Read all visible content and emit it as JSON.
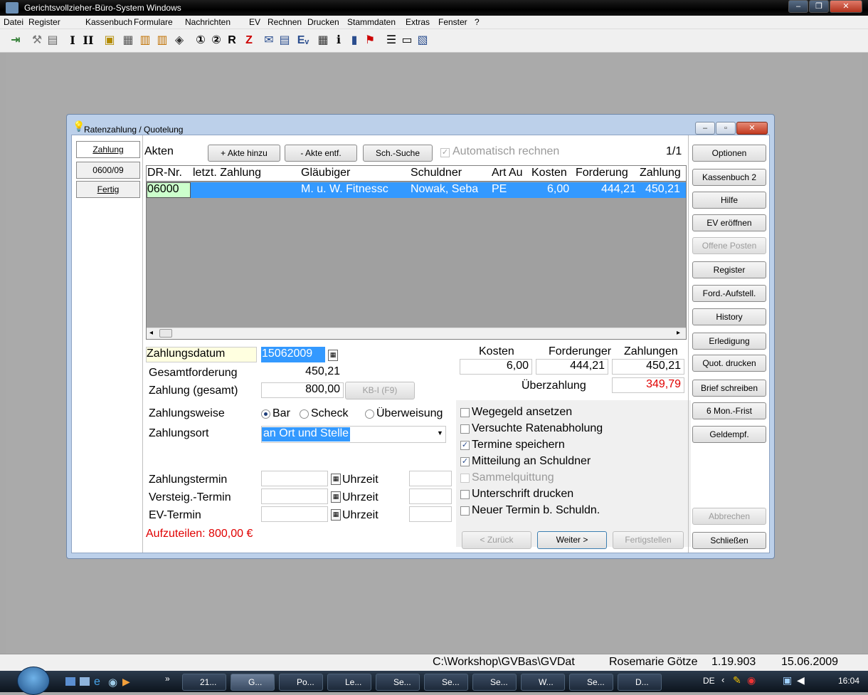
{
  "app": {
    "title": "Gerichtsvollzieher-Büro-System Windows"
  },
  "menu": [
    "Datei",
    "Register",
    "Kassenbuch",
    "Formulare",
    "Nachrichten",
    "EV",
    "Rechnen",
    "Drucken",
    "Stammdaten",
    "Extras",
    "Fenster",
    "?"
  ],
  "dialog": {
    "title": "Ratenzahlung / Quotelung",
    "tabs": [
      "Zahlung",
      "0600/09",
      "Fertig"
    ],
    "akten_label": "Akten",
    "btn_add": "+ Akte hinzu",
    "btn_remove": "- Akte entf.",
    "btn_search": "Sch.-Suche",
    "auto_calc": "Automatisch rechnen",
    "pager": "1/1",
    "columns": [
      "DR-Nr.",
      "letzt. Zahlung",
      "Gläubiger",
      "Schuldner",
      "Art Au",
      "Kosten",
      "Forderung",
      "Zahlung"
    ],
    "row": [
      "06000",
      "",
      "M. u. W. Fitnessc",
      "Nowak, Seba",
      "PE",
      "6,00",
      "444,21",
      "450,21"
    ],
    "zahlungsdatum_label": "Zahlungsdatum",
    "zahlungsdatum": "15062009",
    "gesamtforderung_label": "Gesamtforderung",
    "gesamtforderung": "450,21",
    "zahlung_label": "Zahlung (gesamt)",
    "zahlung": "800,00",
    "kb_button": "KB-I (F9)",
    "summary_headers": [
      "Kosten",
      "Forderunger",
      "Zahlungen"
    ],
    "summary_values": [
      "6,00",
      "444,21",
      "450,21"
    ],
    "ueberzahlung_label": "Überzahlung",
    "ueberzahlung": "349,79",
    "zahlungsweise_label": "Zahlungsweise",
    "radio": [
      "Bar",
      "Scheck",
      "Überweisung"
    ],
    "zahlungsort_label": "Zahlungsort",
    "zahlungsort": "an Ort und Stelle",
    "checks": [
      "Wegegeld ansetzen",
      "Versuchte Ratenabholung",
      "Termine speichern",
      "Mitteilung an Schuldner",
      "Sammelquittung",
      "Unterschrift drucken",
      "Neuer Termin b. Schuldn."
    ],
    "termin_labels": [
      "Zahlungstermin",
      "Versteig.-Termin",
      "EV-Termin"
    ],
    "uhrzeit": "Uhrzeit",
    "aufteilen": "Aufzuteilen: 800,00 €",
    "nav": [
      "< Zurück",
      "Weiter >",
      "Fertigstellen"
    ],
    "side_buttons": [
      "Optionen",
      "Kassenbuch 2",
      "Hilfe",
      "EV eröffnen",
      "Offene Posten",
      "Register",
      "Ford.-Aufstell.",
      "History",
      "Erledigung",
      "Quot. drucken",
      "Brief schreiben",
      "6 Mon.-Frist",
      "Geldempf."
    ],
    "btn_abbrechen": "Abbrechen",
    "btn_schliessen": "Schließen"
  },
  "status": {
    "path": "C:\\Workshop\\GVBas\\GVDat",
    "user": "Rosemarie Götze",
    "version": "1.19.903",
    "date": "15.06.2009"
  },
  "taskbar": {
    "items": [
      "21...",
      "G...",
      "Po...",
      "Le...",
      "Se...",
      "Se...",
      "Se...",
      "W...",
      "Se...",
      "D..."
    ],
    "lang": "DE",
    "time": "16:04"
  }
}
